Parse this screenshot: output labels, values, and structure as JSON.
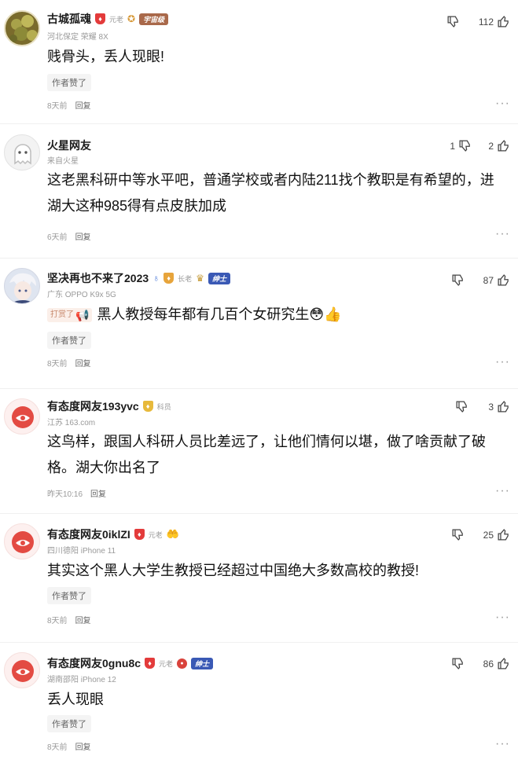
{
  "comments": [
    {
      "username": "古城孤魂",
      "vip_label": "元老",
      "badge_banner": "宇宙级",
      "location_device": "河北保定 荣耀 8X",
      "text": "贱骨头，丢人现眼!",
      "author_liked": "作者赞了",
      "time": "8天前",
      "reply_label": "回复",
      "down_count": "",
      "up_count": "112"
    },
    {
      "username": "火星网友",
      "location_device": "来自火星",
      "text": "这老黑科研中等水平吧，普通学校或者内陆211找个教职是有希望的，进湖大这种985得有点皮肤加成",
      "time": "6天前",
      "reply_label": "回复",
      "down_count": "1",
      "up_count": "2"
    },
    {
      "username": "坚决再也不来了2023",
      "rank_label": "长老",
      "badge_banner": "绅士",
      "location_device": "广东 OPPO K9x 5G",
      "tipped_label": "打赏了",
      "text": "黑人教授每年都有几百个女研究生😳👍",
      "author_liked": "作者赞了",
      "time": "8天前",
      "reply_label": "回复",
      "down_count": "",
      "up_count": "87"
    },
    {
      "username": "有态度网友193yvc",
      "rank_label": "科员",
      "location_device": "江苏 163.com",
      "text": "这鸟样，跟国人科研人员比差远了，让他们情何以堪，做了啥贡献了破格。湖大你出名了",
      "time": "昨天10:16",
      "reply_label": "回复",
      "down_count": "",
      "up_count": "3"
    },
    {
      "username": "有态度网友0iklZI",
      "vip_label": "元老",
      "location_device": "四川德阳 iPhone 11",
      "text": "其实这个黑人大学生教授已经超过中国绝大多数高校的教授!",
      "author_liked": "作者赞了",
      "time": "8天前",
      "reply_label": "回复",
      "down_count": "",
      "up_count": "25"
    },
    {
      "username": "有态度网友0gnu8c",
      "vip_label": "元老",
      "badge_banner": "绅士",
      "location_device": "湖南邵阳 iPhone 12",
      "text": "丢人现眼",
      "author_liked": "作者赞了",
      "time": "8天前",
      "reply_label": "回复",
      "down_count": "",
      "up_count": "86"
    }
  ],
  "colors": {
    "vip_red": "#e33b3b",
    "banner_brown": "#a9694a",
    "banner_blue": "#3a59b5",
    "meta_gray": "#9a9a9a"
  },
  "icons": [
    "thumbs-down-icon",
    "thumbs-up-icon",
    "more-icon",
    "horn-icon",
    "vip-shield-icon",
    "medal-icon"
  ]
}
